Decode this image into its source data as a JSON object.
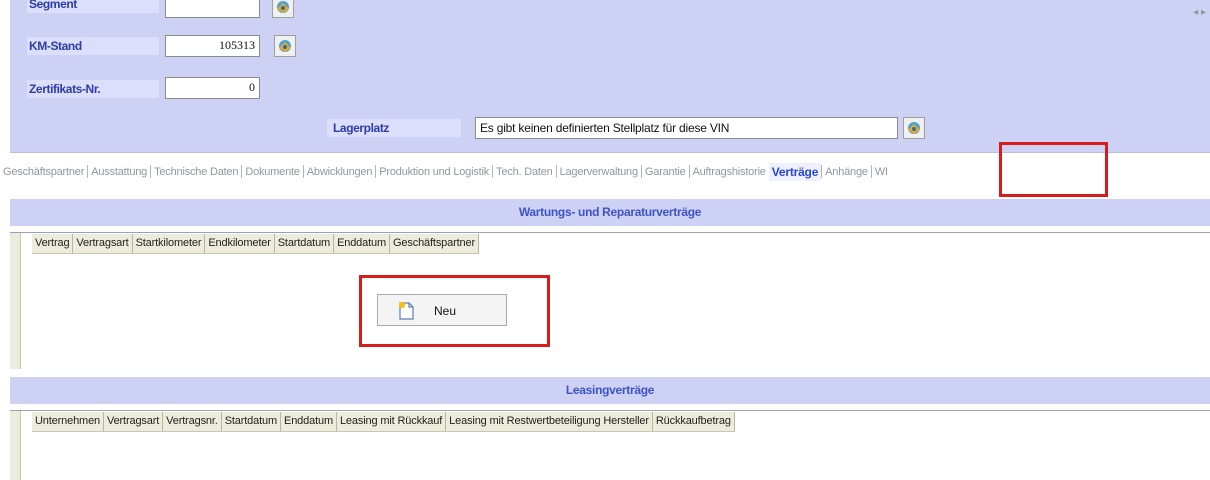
{
  "vehicle_form": {
    "segment": {
      "label": "Segment",
      "value": ""
    },
    "km_stand": {
      "label": "KM-Stand",
      "value": "105313"
    },
    "zertifikat": {
      "label": "Zertifikats-Nr.",
      "value": "0"
    },
    "lagerplatz": {
      "label": "Lagerplatz",
      "value": "Es gibt keinen definierten Stellplatz für diese VIN"
    }
  },
  "tabs": [
    {
      "label": "Geschäftspartner"
    },
    {
      "label": "Ausstattung"
    },
    {
      "label": "Technische Daten"
    },
    {
      "label": "Dokumente"
    },
    {
      "label": "Abwicklungen"
    },
    {
      "label": "Produktion und Logistik"
    },
    {
      "label": "Tech. Daten"
    },
    {
      "label": "Lagerverwaltung"
    },
    {
      "label": "Garantie"
    },
    {
      "label": "Auftragshistorie"
    },
    {
      "label": "Verträge",
      "active": true
    },
    {
      "label": "Anhänge"
    },
    {
      "label": "WI"
    }
  ],
  "tab_scroll": "◂ ▸",
  "wartung": {
    "title": "Wartungs- und Reparaturverträge",
    "columns": [
      "Vertrag",
      "Vertragsart",
      "Startkilometer",
      "Endkilometer",
      "Startdatum",
      "Enddatum",
      "Geschäftspartner"
    ],
    "new_button": "Neu"
  },
  "leasing": {
    "title": "Leasingverträge",
    "columns": [
      "Unternehmen",
      "Vertragsart",
      "Vertragsnr.",
      "Startdatum",
      "Enddatum",
      "Leasing mit Rückkauf",
      "Leasing mit Restwertbeteiligung Hersteller",
      "Rückkaufbetrag"
    ]
  },
  "colors": {
    "panel": "#cdd1f4",
    "label_text": "#2d3ca8",
    "active_tab": "#2847d8",
    "highlight": "#d81c1c"
  },
  "icons": [
    "vehicle-pick-icon",
    "new-document-icon"
  ]
}
